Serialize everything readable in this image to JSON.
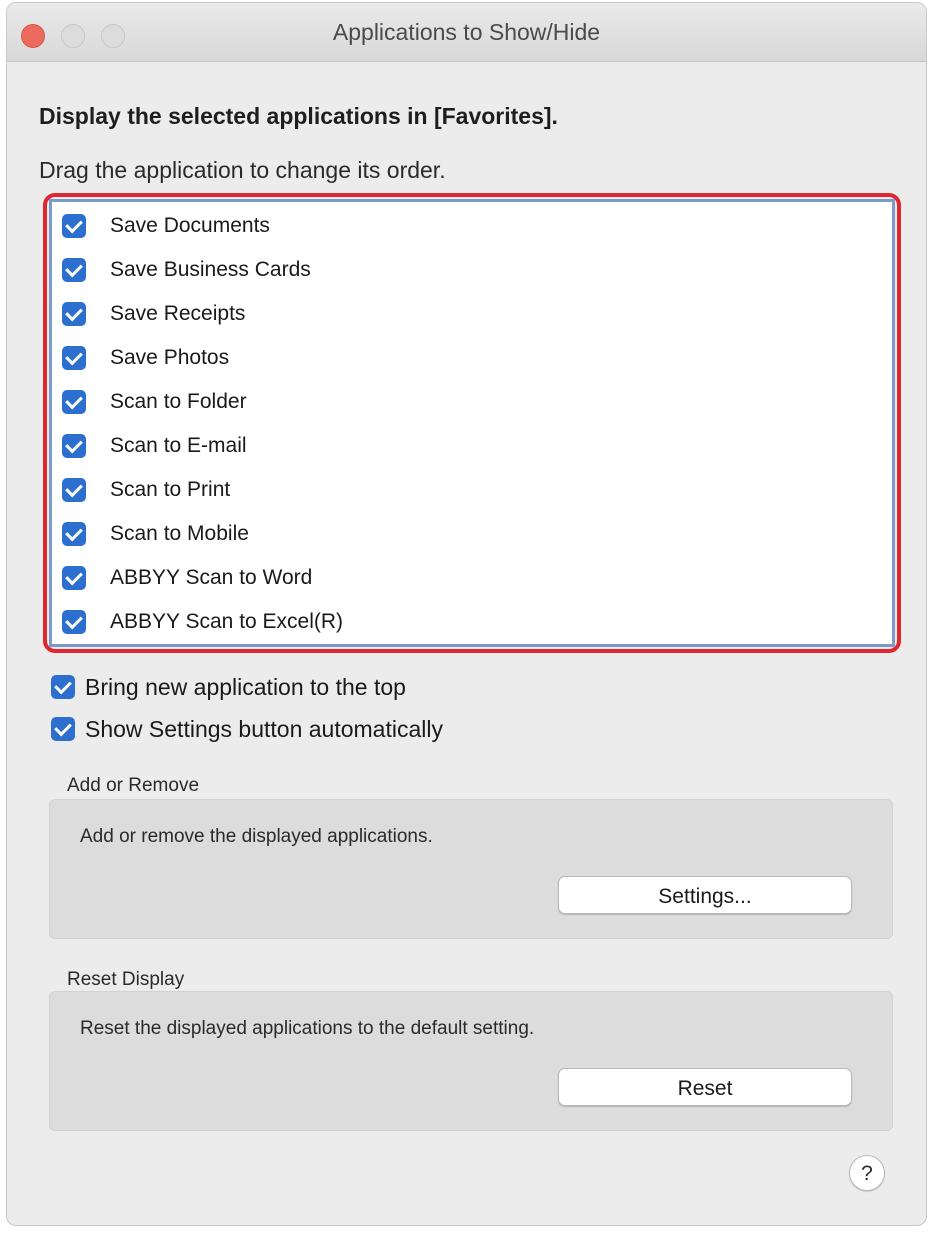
{
  "window": {
    "title": "Applications to Show/Hide"
  },
  "heading": "Display the selected applications in [Favorites].",
  "subheading": "Drag the application to change its order.",
  "applications": [
    {
      "label": "Save Documents",
      "checked": true
    },
    {
      "label": "Save Business Cards",
      "checked": true
    },
    {
      "label": "Save Receipts",
      "checked": true
    },
    {
      "label": "Save Photos",
      "checked": true
    },
    {
      "label": "Scan to Folder",
      "checked": true
    },
    {
      "label": "Scan to E-mail",
      "checked": true
    },
    {
      "label": "Scan to Print",
      "checked": true
    },
    {
      "label": "Scan to Mobile",
      "checked": true
    },
    {
      "label": "ABBYY Scan to Word",
      "checked": true
    },
    {
      "label": "ABBYY Scan to Excel(R)",
      "checked": true
    }
  ],
  "options": [
    {
      "label": "Bring new application to the top",
      "checked": true
    },
    {
      "label": "Show Settings button automatically",
      "checked": true
    }
  ],
  "add_remove": {
    "title": "Add or Remove",
    "description": "Add or remove the displayed applications.",
    "button": "Settings..."
  },
  "reset_display": {
    "title": "Reset Display",
    "description": "Reset the displayed applications to the default setting.",
    "button": "Reset"
  },
  "help": {
    "label": "?"
  },
  "colors": {
    "checkbox": "#2d6fce",
    "highlight": "#e0262e",
    "list_border": "#7b99c9",
    "close": "#ed6a5e"
  }
}
